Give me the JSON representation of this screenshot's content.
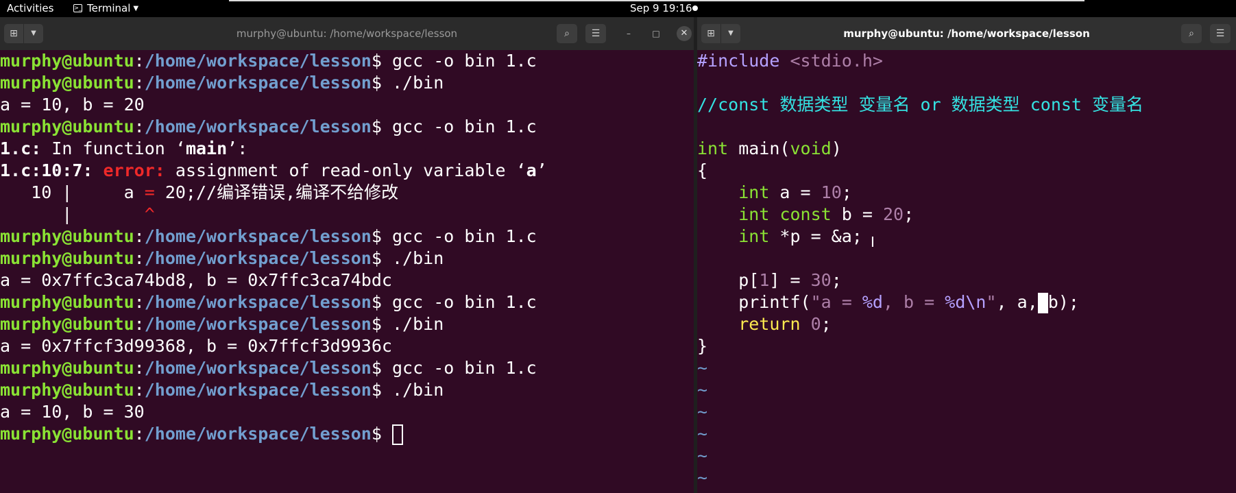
{
  "topbar": {
    "activities": "Activities",
    "app_name": "Terminal",
    "app_menu_icon": "terminal-icon",
    "clock": "Sep 9  19:16"
  },
  "left_window": {
    "title": "murphy@ubuntu: /home/workspace/lesson",
    "prompt_user": "murphy@ubuntu",
    "prompt_path": "/home/workspace/lesson",
    "prompt_symbol": "$ ",
    "lines": [
      {
        "type": "prompt",
        "cmd": "gcc -o bin 1.c"
      },
      {
        "type": "prompt",
        "cmd": "./bin"
      },
      {
        "type": "out",
        "text": "a = 10, b = 20"
      },
      {
        "type": "prompt",
        "cmd": "gcc -o bin 1.c"
      },
      {
        "type": "fn",
        "file": "1.c:",
        "text": " In function ‘",
        "name": "main",
        "end": "’:"
      },
      {
        "type": "error",
        "loc": "1.c:10:7:",
        "label": "error:",
        "text": " assignment of read-only variable ‘",
        "var": "a",
        "end": "’"
      },
      {
        "type": "src",
        "pre": "   10 |     a ",
        "mark": "=",
        "post": " 20;//编译错误,编译不给修改"
      },
      {
        "type": "caret",
        "pre": "      |       ",
        "mark": "^"
      },
      {
        "type": "prompt",
        "cmd": "gcc -o bin 1.c"
      },
      {
        "type": "prompt",
        "cmd": "./bin"
      },
      {
        "type": "out",
        "text": "a = 0x7ffc3ca74bd8, b = 0x7ffc3ca74bdc"
      },
      {
        "type": "prompt",
        "cmd": "gcc -o bin 1.c"
      },
      {
        "type": "prompt",
        "cmd": "./bin"
      },
      {
        "type": "out",
        "text": "a = 0x7ffcf3d99368, b = 0x7ffcf3d9936c"
      },
      {
        "type": "prompt",
        "cmd": "gcc -o bin 1.c"
      },
      {
        "type": "prompt",
        "cmd": "./bin"
      },
      {
        "type": "out",
        "text": "a = 10, b = 30"
      },
      {
        "type": "prompt_cursor",
        "cmd": ""
      }
    ]
  },
  "right_window": {
    "title": "murphy@ubuntu: /home/workspace/lesson",
    "code": [
      [
        {
          "c": "pre",
          "t": "#include "
        },
        {
          "c": "str",
          "t": "<stdio.h>"
        }
      ],
      [],
      [
        {
          "c": "cmt",
          "t": "//const 数据类型 变量名 or 数据类型 const 变量名"
        }
      ],
      [],
      [
        {
          "c": "type",
          "t": "int"
        },
        {
          "c": "",
          "t": " main("
        },
        {
          "c": "type",
          "t": "void"
        },
        {
          "c": "",
          "t": ")"
        }
      ],
      [
        {
          "c": "",
          "t": "{"
        }
      ],
      [
        {
          "c": "",
          "t": "    "
        },
        {
          "c": "type",
          "t": "int"
        },
        {
          "c": "",
          "t": " a = "
        },
        {
          "c": "num",
          "t": "10"
        },
        {
          "c": "",
          "t": ";"
        }
      ],
      [
        {
          "c": "",
          "t": "    "
        },
        {
          "c": "type",
          "t": "int"
        },
        {
          "c": "",
          "t": " "
        },
        {
          "c": "type",
          "t": "const"
        },
        {
          "c": "",
          "t": " b = "
        },
        {
          "c": "num",
          "t": "20"
        },
        {
          "c": "",
          "t": ";"
        }
      ],
      [
        {
          "c": "",
          "t": "    "
        },
        {
          "c": "type",
          "t": "int"
        },
        {
          "c": "",
          "t": " *p = &a;"
        }
      ],
      [],
      [
        {
          "c": "",
          "t": "    p["
        },
        {
          "c": "num",
          "t": "1"
        },
        {
          "c": "",
          "t": "] = "
        },
        {
          "c": "num",
          "t": "30"
        },
        {
          "c": "",
          "t": ";"
        }
      ],
      [
        {
          "c": "",
          "t": "    printf("
        },
        {
          "c": "str",
          "t": "\"a = "
        },
        {
          "c": "pre",
          "t": "%d"
        },
        {
          "c": "str",
          "t": ", b = "
        },
        {
          "c": "pre",
          "t": "%d\\n"
        },
        {
          "c": "str",
          "t": "\""
        },
        {
          "c": "",
          "t": ", a,"
        },
        {
          "c": "cursor",
          "t": ""
        },
        {
          "c": "",
          "t": "b);"
        }
      ],
      [
        {
          "c": "",
          "t": "    "
        },
        {
          "c": "kw",
          "t": "return"
        },
        {
          "c": "",
          "t": " "
        },
        {
          "c": "num",
          "t": "0"
        },
        {
          "c": "",
          "t": ";"
        }
      ],
      [
        {
          "c": "",
          "t": "}"
        }
      ],
      [
        {
          "c": "tilde",
          "t": "~"
        }
      ],
      [
        {
          "c": "tilde",
          "t": "~"
        }
      ],
      [
        {
          "c": "tilde",
          "t": "~"
        }
      ],
      [
        {
          "c": "tilde",
          "t": "~"
        }
      ],
      [
        {
          "c": "tilde",
          "t": "~"
        }
      ],
      [
        {
          "c": "tilde",
          "t": "~"
        }
      ]
    ]
  },
  "colors": {
    "terminal_bg": "#300a24",
    "prompt_user": "#8ae234",
    "prompt_path": "#729fcf",
    "error": "#ef2929"
  }
}
